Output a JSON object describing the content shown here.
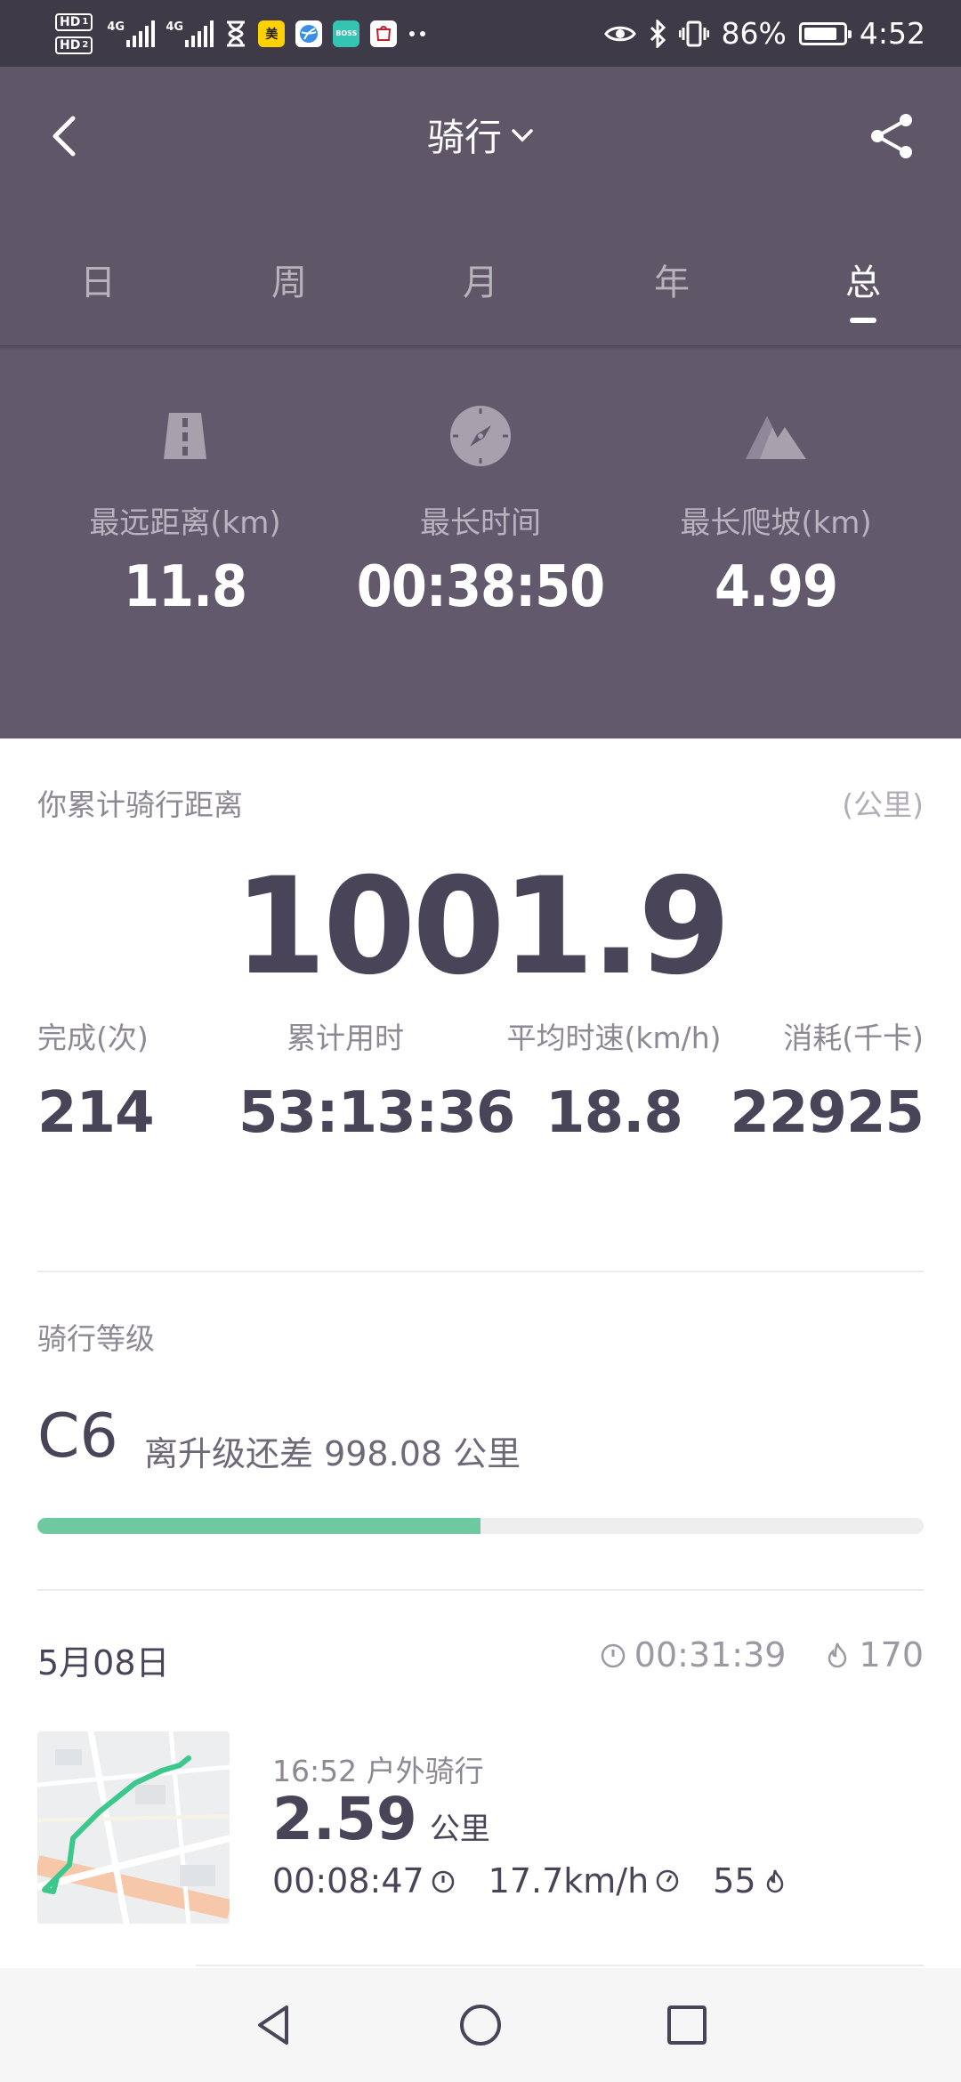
{
  "status_bar": {
    "network_1": "4G",
    "network_2": "4G",
    "app_meituan": "美",
    "app_boss": "BOSS",
    "battery_percent": "86%",
    "battery_level": 0.86,
    "time": "4:52"
  },
  "header": {
    "title": "骑行",
    "tabs": [
      "日",
      "周",
      "月",
      "年",
      "总"
    ],
    "active_tab": "总"
  },
  "records": [
    {
      "label": "最远距离(km)",
      "value": "11.8",
      "icon": "road-icon"
    },
    {
      "label": "最长时间",
      "value": "00:38:50",
      "icon": "compass-icon"
    },
    {
      "label": "最长爬坡(km)",
      "value": "4.99",
      "icon": "mountain-icon"
    }
  ],
  "total": {
    "label": "你累计骑行距离",
    "unit": "(公里)",
    "value": "1001.9"
  },
  "stats": [
    {
      "label": "完成(次)",
      "value": "214"
    },
    {
      "label": "累计用时",
      "value": "53:13:36"
    },
    {
      "label": "平均时速(km/h)",
      "value": "18.8"
    },
    {
      "label": "消耗(千卡)",
      "value": "22925"
    }
  ],
  "level": {
    "label": "骑行等级",
    "code": "C6",
    "text": "离升级还差 998.08 公里",
    "progress": 0.5
  },
  "day": {
    "date": "5月08日",
    "duration": "00:31:39",
    "calories": "170"
  },
  "activity": {
    "time_type": "16:52 户外骑行",
    "distance": "2.59",
    "distance_unit": "公里",
    "duration": "00:08:47",
    "speed": "17.7km/h",
    "calories": "55"
  },
  "colors": {
    "header_bg": "#5f5768",
    "records_bg": "#625a6c",
    "status_bg": "#3f3a47",
    "text_dark": "#4a4458",
    "progress_green": "#6ec8a0",
    "route_green": "#3cc88c"
  }
}
